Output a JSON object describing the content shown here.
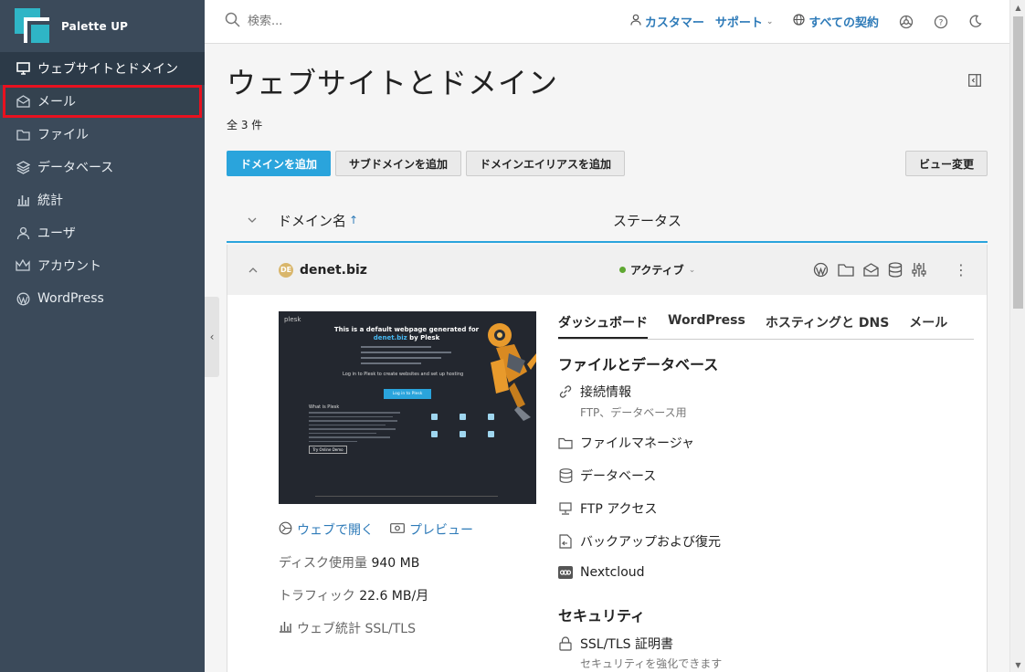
{
  "brand": {
    "name": "Palette UP"
  },
  "sidebar": {
    "items": [
      {
        "label": "ウェブサイトとドメイン",
        "icon": "monitor-icon"
      },
      {
        "label": "メール",
        "icon": "mail-icon"
      },
      {
        "label": "ファイル",
        "icon": "folder-icon"
      },
      {
        "label": "データベース",
        "icon": "layers-icon"
      },
      {
        "label": "統計",
        "icon": "bar-chart-icon"
      },
      {
        "label": "ユーザ",
        "icon": "user-icon"
      },
      {
        "label": "アカウント",
        "icon": "crown-icon"
      },
      {
        "label": "WordPress",
        "icon": "wordpress-icon"
      }
    ],
    "active_index": 0,
    "highlighted_index": 1
  },
  "header": {
    "search_placeholder": "検索...",
    "customer_label": "カスタマー",
    "support_label": "サポート",
    "subscriptions_label": "すべての契約"
  },
  "page": {
    "title": "ウェブサイトとドメイン",
    "count_label": "全 3 件"
  },
  "toolbar": {
    "add_domain": "ドメインを追加",
    "add_subdomain": "サブドメインを追加",
    "add_alias": "ドメインエイリアスを追加",
    "change_view": "ビュー変更"
  },
  "table": {
    "col_name": "ドメイン名",
    "col_status": "ステータス"
  },
  "domain": {
    "badge": "DE",
    "name": "denet.biz",
    "status": "アクティブ",
    "status_color": "#5fa832",
    "preview": {
      "logo": "plesk",
      "title_line1": "This is a default webpage generated for",
      "title_domain": "denet.biz",
      "title_line2": "by Plesk",
      "subtitle": "Log in to Plesk to create websites and set up hosting",
      "button": "Log in to Plesk",
      "what_heading": "What is Plesk",
      "demo_button": "Try Online Demo"
    },
    "open_web_label": "ウェブで開く",
    "preview_label": "プレビュー",
    "disk_label": "ディスク使用量",
    "disk_value": "940 MB",
    "traffic_label": "トラフィック",
    "traffic_value": "22.6 MB/月",
    "stats_label": "ウェブ統計 SSL/TLS"
  },
  "tabs": [
    {
      "label": "ダッシュボード"
    },
    {
      "label": "WordPress"
    },
    {
      "label": "ホスティングと DNS"
    },
    {
      "label": "メール"
    }
  ],
  "dashboard": {
    "files_heading": "ファイルとデータベース",
    "connection_label": "接続情報",
    "connection_sub": "FTP、データベース用",
    "file_manager": "ファイルマネージャ",
    "databases": "データベース",
    "ftp_access": "FTP アクセス",
    "backup": "バックアップおよび復元",
    "nextcloud": "Nextcloud",
    "security_heading": "セキュリティ",
    "ssl_label": "SSL/TLS 証明書",
    "ssl_sub": "セキュリティを強化できます"
  },
  "colors": {
    "sidebar_bg": "#3b4a5a",
    "accent": "#2aa4dc",
    "link": "#2d7ab8",
    "highlight_border": "#e8111f"
  }
}
